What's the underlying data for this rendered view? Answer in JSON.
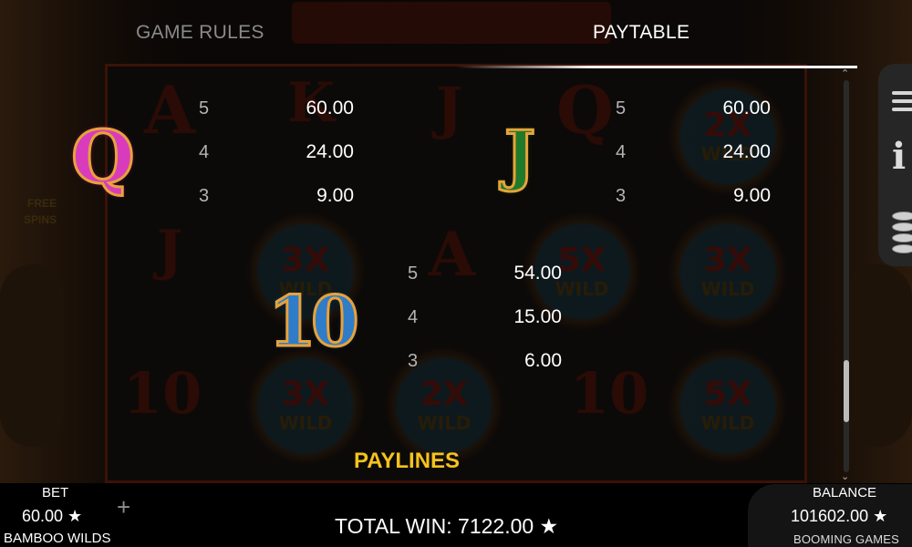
{
  "background": {
    "logo_text": "BAMBOO WILDS",
    "reel_letters": [
      "A",
      "K",
      "J",
      "Q",
      "J",
      "J",
      "A",
      "10",
      "10"
    ],
    "wild_tiles": [
      {
        "mult": "2X",
        "word": "WILD"
      },
      {
        "mult": "3X",
        "word": "WILD"
      },
      {
        "mult": "5X",
        "word": "WILD"
      },
      {
        "mult": "3X",
        "word": "WILD"
      },
      {
        "mult": "3X",
        "word": "WILD"
      },
      {
        "mult": "2X",
        "word": "WILD"
      },
      {
        "mult": "5X",
        "word": "WILD"
      }
    ],
    "side_text": "FREE SPINS"
  },
  "tabs": {
    "game_rules": "GAME RULES",
    "paytable": "PAYTABLE",
    "active": "paytable"
  },
  "paytable": {
    "q": {
      "symbol": "Q",
      "rows": [
        {
          "count": "5",
          "value": "60.00"
        },
        {
          "count": "4",
          "value": "24.00"
        },
        {
          "count": "3",
          "value": "9.00"
        }
      ]
    },
    "j": {
      "symbol": "J",
      "rows": [
        {
          "count": "5",
          "value": "60.00"
        },
        {
          "count": "4",
          "value": "24.00"
        },
        {
          "count": "3",
          "value": "9.00"
        }
      ]
    },
    "ten": {
      "symbol": "10",
      "rows": [
        {
          "count": "5",
          "value": "54.00"
        },
        {
          "count": "4",
          "value": "15.00"
        },
        {
          "count": "3",
          "value": "6.00"
        }
      ]
    },
    "next_section": "PAYLINES"
  },
  "scroll": {
    "position_fraction": 0.72
  },
  "side_menu": {
    "icons": [
      "menu-icon",
      "info-icon",
      "coins-icon"
    ]
  },
  "footer": {
    "bet_label": "BET",
    "bet_value": "60.00 ★",
    "game_name": "BAMBOO WILDS",
    "plus": "+",
    "total_win": "TOTAL WIN: 7122.00 ★",
    "balance_label": "BALANCE",
    "balance_value": "101602.00 ★",
    "brand": "BOOMING GAMES"
  },
  "colors": {
    "accent_yellow": "#f6c21c",
    "text_white": "#ffffff",
    "text_muted": "#8a8a8a"
  }
}
